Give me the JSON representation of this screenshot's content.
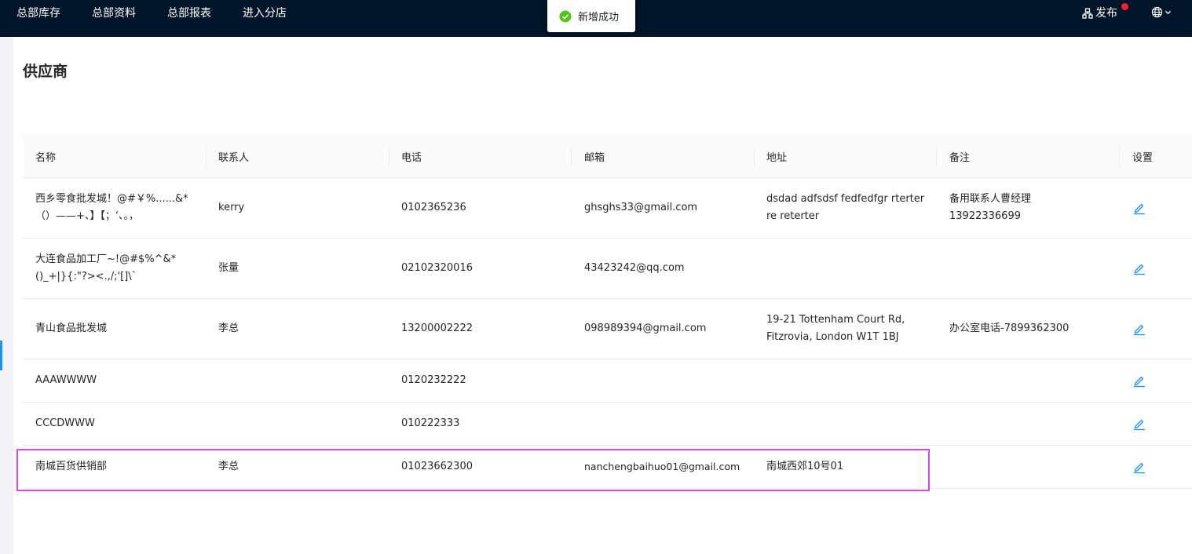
{
  "nav": {
    "items": [
      "总部库存",
      "总部资料",
      "总部报表",
      "进入分店"
    ],
    "publish_label": "发布"
  },
  "toast": {
    "message": "新增成功"
  },
  "page": {
    "title": "供应商"
  },
  "table": {
    "columns": [
      "名称",
      "联系人",
      "电话",
      "邮箱",
      "地址",
      "备注",
      "设置"
    ],
    "rows": [
      {
        "name": "西乡零食批发城！@#￥%......&*（）——+、】【；‘、。，",
        "contact": "kerry",
        "phone": "0102365236",
        "email": "ghsghs33@gmail.com",
        "address": "dsdad adfsdsf fedfedfgr rterter re reterter",
        "note": "备用联系人曹经理 13922336699"
      },
      {
        "name": "大连食品加工厂~!@#$%^&*()_+|}{:\"?><.,/;'[]\\`",
        "contact": "张量",
        "phone": "02102320016",
        "email": "43423242@qq.com",
        "address": "",
        "note": ""
      },
      {
        "name": "青山食品批发城",
        "contact": "李总",
        "phone": "13200002222",
        "email": "098989394@gmail.com",
        "address": "19-21 Tottenham Court Rd, Fitzrovia, London W1T 1BJ",
        "note": "办公室电话-7899362300"
      },
      {
        "name": "AAAWWWW",
        "contact": "",
        "phone": "0120232222",
        "email": "",
        "address": "",
        "note": ""
      },
      {
        "name": "CCCDWWW",
        "contact": "",
        "phone": "010222333",
        "email": "",
        "address": "",
        "note": ""
      },
      {
        "name": "南城百货供销部",
        "contact": "李总",
        "phone": "01023662300",
        "email": "nanchengbaihuo01@gmail.com",
        "address": "南城西郊10号01",
        "note": ""
      }
    ]
  },
  "colors": {
    "topbar": "#001529",
    "link": "#1890ff",
    "success": "#52c41a",
    "highlight": "#d946ef",
    "badge": "#f5222d"
  },
  "icons": {
    "publish": "network-icon",
    "language": "globe-icon",
    "edit": "edit-icon",
    "success": "check-circle-icon"
  }
}
